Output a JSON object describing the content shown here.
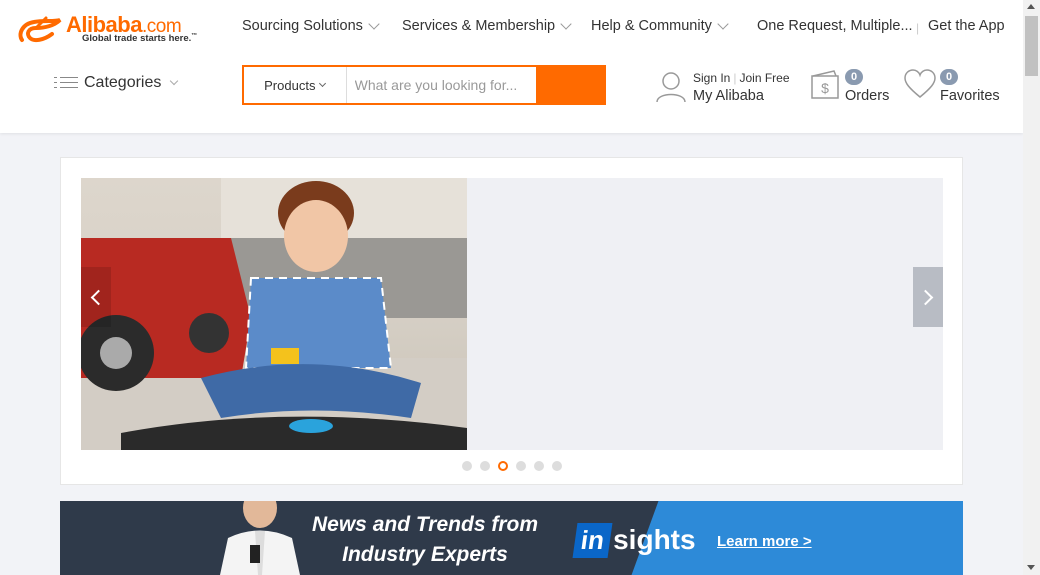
{
  "brand": {
    "name": "Alibaba",
    "domain_suffix": ".com",
    "tagline": "Global trade starts here.",
    "trademark": "™",
    "color": "#ff6a00"
  },
  "topnav": {
    "sourcing": "Sourcing Solutions",
    "services": "Services & Membership",
    "help": "Help & Community",
    "one_request": "One Request, Multiple...",
    "get_app": "Get the App"
  },
  "categories": {
    "label": "Categories"
  },
  "search": {
    "category": "Products",
    "placeholder": "What are you looking for..."
  },
  "user": {
    "sign_in": "Sign In",
    "join_free": "Join Free",
    "my_alibaba": "My Alibaba"
  },
  "orders": {
    "count": "0",
    "label": "Orders"
  },
  "favorites": {
    "count": "0",
    "label": "Favorites"
  },
  "carousel": {
    "slides": 6,
    "active_slide": 3
  },
  "banner": {
    "headline_line1": "News and Trends from",
    "headline_line2": "Industry Experts",
    "logo_in": "in",
    "logo_sights": "sights",
    "learn_more": "Learn more >"
  }
}
